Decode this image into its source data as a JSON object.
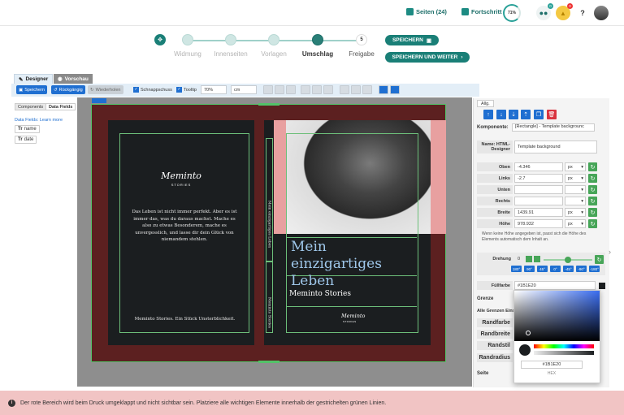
{
  "topbar": {
    "pages_label": "Seiten (24)",
    "progress_label": "Fortschritt",
    "progress_value": "71%",
    "users_badge": "0",
    "notif_badge": "0",
    "help": "?"
  },
  "stepper": {
    "steps": [
      {
        "label": "Widmung"
      },
      {
        "label": "Innenseiten"
      },
      {
        "label": "Vorlagen"
      },
      {
        "label": "Umschlag"
      },
      {
        "label": "Freigabe",
        "number": "5"
      }
    ],
    "save_label": "SPEICHERN",
    "save_next_label": "SPEICHERN UND WEITER"
  },
  "tabs": {
    "designer": "Designer",
    "preview": "Vorschau"
  },
  "toolbar": {
    "save": "Speichern",
    "undo": "Rückgängig",
    "redo": "Wiederholen",
    "snap": "Schnappschuss",
    "tooltip": "Tooltip",
    "zoom": "70%",
    "unit": "cm"
  },
  "leftpanel": {
    "tab_components": "Components",
    "tab_datafields": "Data Fields",
    "learn_more": "Data Fields: Learn more",
    "fields": [
      "name",
      "date"
    ]
  },
  "cover": {
    "logo_name": "Meminto",
    "logo_sub": "STORIES",
    "back_text": "Das Leben ist nicht immer perfekt. Aber es ist immer das, was du daraus machst. Mache es also zu etwas Besonderem, mache es unvergesslich, und lasse dir dein Glück von niemandem stehlen.",
    "back_tagline": "Meminto Stories. Ein Stück Unsterblichkeit.",
    "spine_title": "Mein einzigartiges Leben",
    "spine_author": "Meminto Stories",
    "front_title": "Mein einzigartiges Leben",
    "front_subtitle": "Meminto Stories"
  },
  "rightpanel": {
    "tab": "Allg.",
    "component_label": "Komponente:",
    "component_value": "[Rectangle] - Template backgrounc",
    "name_label": "Name: HTML-Designer",
    "name_value": "Template background",
    "fields": [
      {
        "label": "Oben",
        "value": "-4.346",
        "unit": "px"
      },
      {
        "label": "Links",
        "value": "-2.7",
        "unit": "px"
      },
      {
        "label": "Unten",
        "value": "",
        "unit": ""
      },
      {
        "label": "Rechts",
        "value": "",
        "unit": ""
      },
      {
        "label": "Breite",
        "value": "1439.91",
        "unit": "px"
      },
      {
        "label": "Höhe",
        "value": "978.932",
        "unit": "px"
      }
    ],
    "height_note": "Wenn keine Höhe angegeben ist, passt sich die Höhe des Elements automatisch dem Inhalt an.",
    "rotation_label": "Drehung",
    "rotation_value": "0",
    "degrees": [
      "180°",
      "90°",
      "45°",
      "0°",
      "-45°",
      "-90°",
      "-180°"
    ],
    "fill_label": "Füllfarbe",
    "fill_value": "#1B1E20",
    "border_section": "Grenze",
    "all_borders": "Alle Grenzen Einst",
    "border_color": "Randfarbe",
    "border_width": "Randbreite",
    "border_style": "Randstil",
    "border_radius": "Randradius",
    "page_section": "Seite"
  },
  "picker": {
    "hex": "#1B1E20",
    "hex_label": "HEX"
  },
  "footer": {
    "message": "Der rote Bereich wird beim Druck umgeklappt und nicht sichtbar sein. Platziere alle wichtigen Elemente innerhalb der gestrichelten grünen Linien."
  },
  "colors": {
    "accent": "#1a7f77",
    "fill": "#1B1E20",
    "bleed": "#5c2020",
    "blue": "#1f6fd1"
  }
}
